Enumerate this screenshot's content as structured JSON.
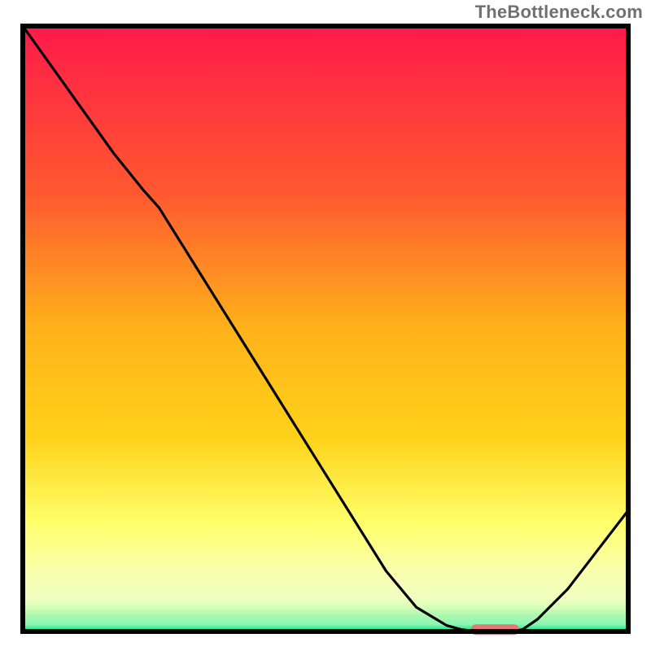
{
  "watermark": "TheBottleneck.com",
  "colors": {
    "gradient_top": "#ff1a4a",
    "gradient_mid_upper": "#ff7a2a",
    "gradient_mid": "#ffd21a",
    "gradient_lower": "#ffff6a",
    "gradient_band1": "#f9ffb0",
    "gradient_band2": "#d6ffb8",
    "gradient_band3": "#8cf7b4",
    "gradient_bottom": "#00e67a",
    "frame": "#000000",
    "curve": "#000000",
    "marker": "#e07a7a"
  },
  "plot": {
    "viewbox_w": 756,
    "viewbox_h": 756,
    "inner_x": 6,
    "inner_y": 6,
    "inner_w": 744,
    "inner_h": 744
  },
  "chart_data": {
    "type": "line",
    "title": "",
    "xlabel": "",
    "ylabel": "",
    "xlim": [
      0,
      1
    ],
    "ylim": [
      0,
      1
    ],
    "annotations": [
      "TheBottleneck.com"
    ],
    "x": [
      0.0,
      0.05,
      0.1,
      0.15,
      0.2,
      0.225,
      0.25,
      0.3,
      0.35,
      0.4,
      0.45,
      0.5,
      0.55,
      0.6,
      0.65,
      0.7,
      0.725,
      0.75,
      0.8,
      0.825,
      0.85,
      0.9,
      0.95,
      1.0
    ],
    "values": [
      1.0,
      0.93,
      0.86,
      0.79,
      0.728,
      0.7,
      0.66,
      0.58,
      0.5,
      0.42,
      0.34,
      0.26,
      0.18,
      0.1,
      0.04,
      0.01,
      0.003,
      0.0,
      0.0,
      0.003,
      0.02,
      0.07,
      0.135,
      0.2
    ],
    "marker": {
      "x0": 0.74,
      "x1": 0.82,
      "y": 0.003
    }
  }
}
